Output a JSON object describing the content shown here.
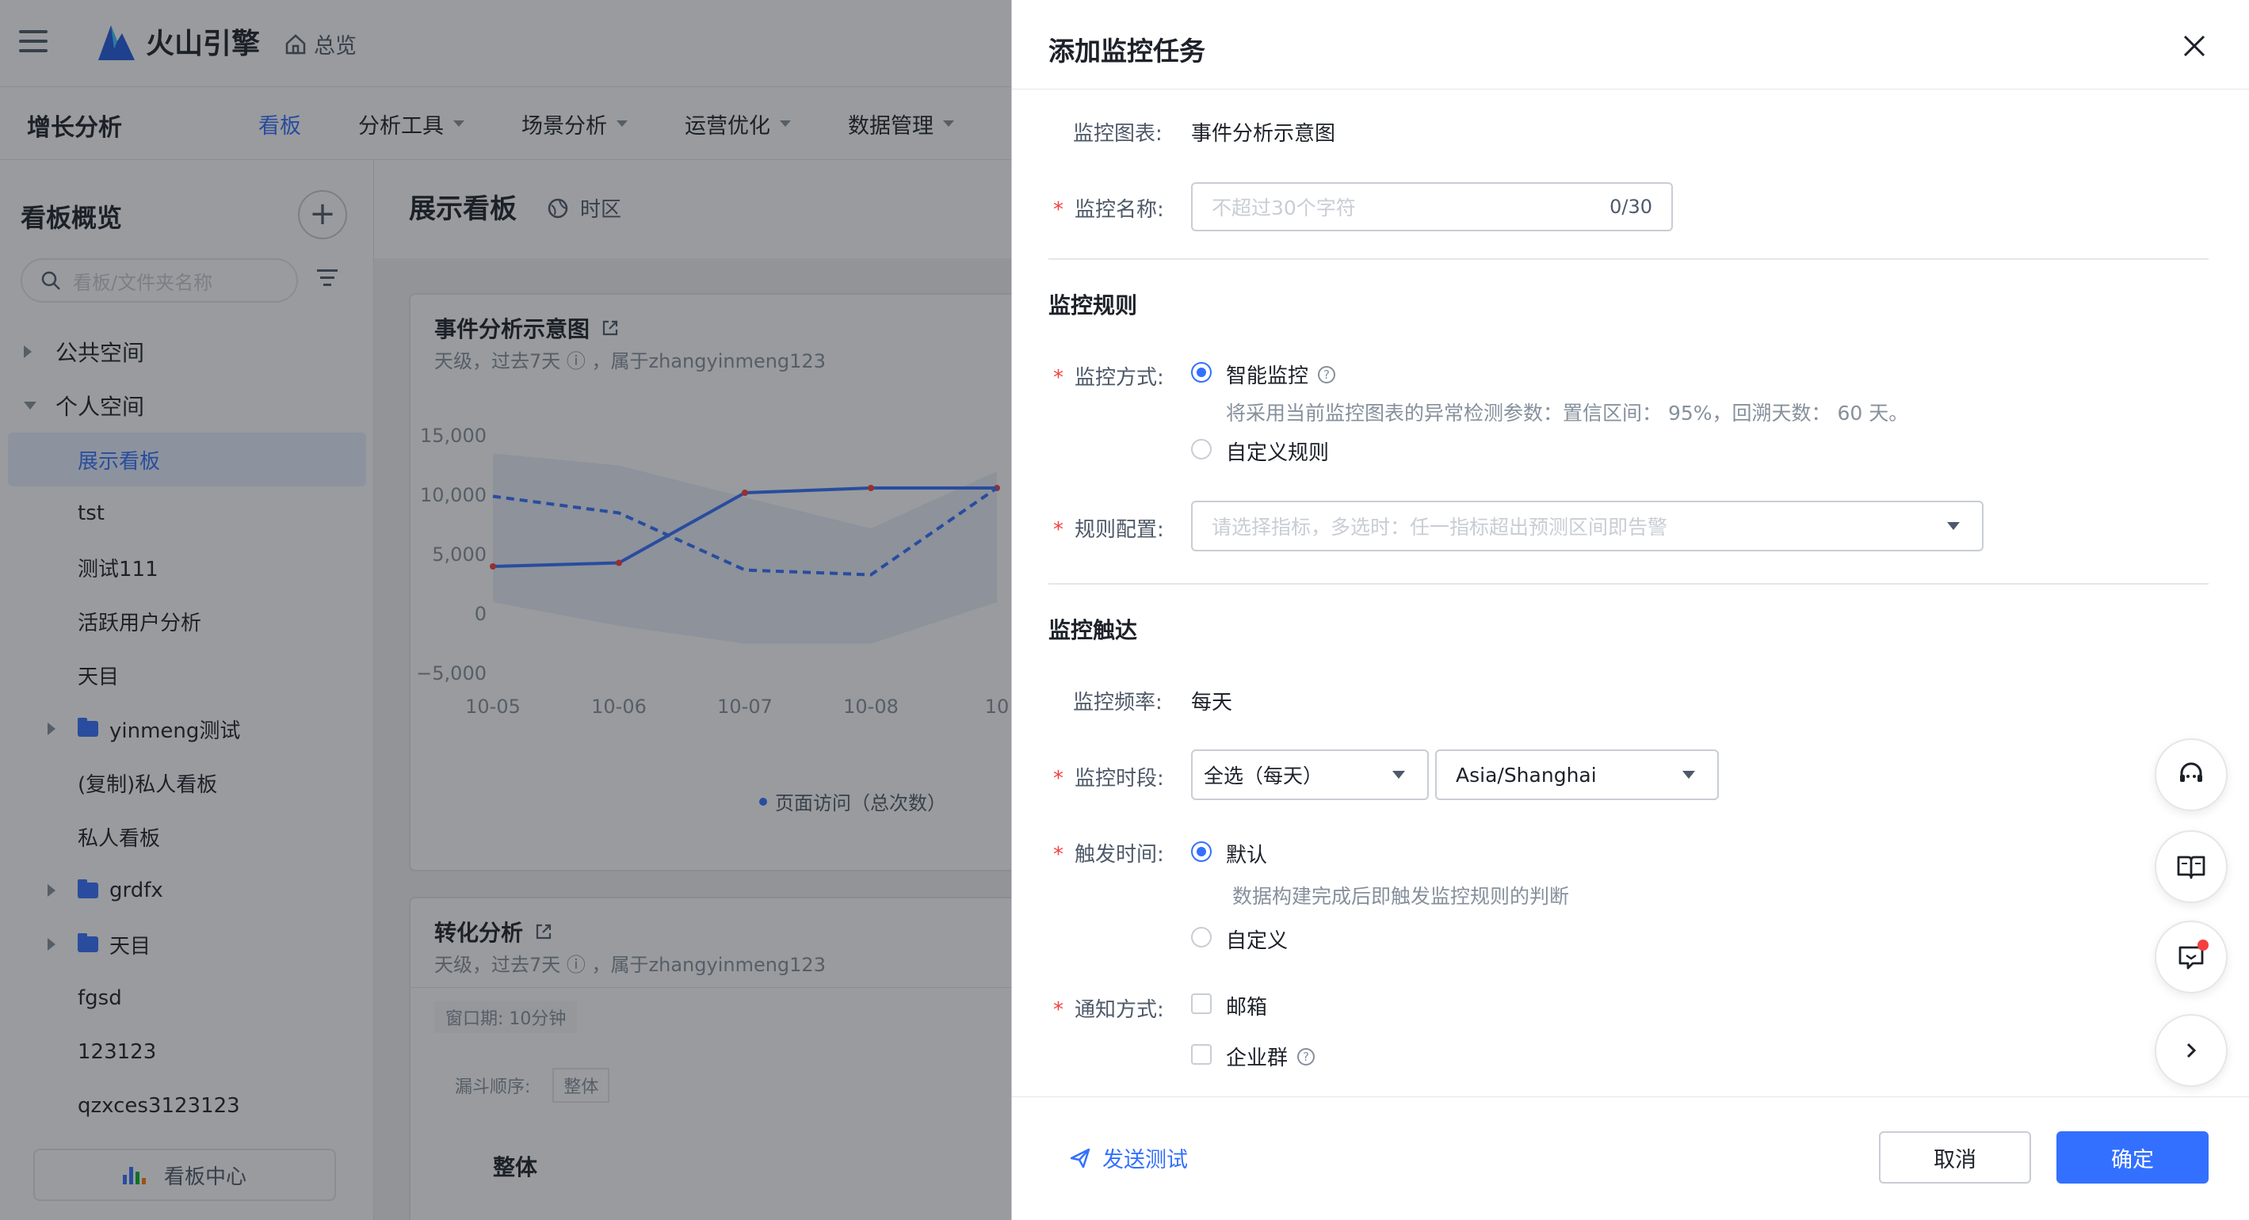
{
  "header": {
    "logo_text": "火山引擎",
    "home_label": "总览"
  },
  "nav": {
    "product_title": "增长分析",
    "items": [
      {
        "label": "看板",
        "active": true,
        "dropdown": false
      },
      {
        "label": "分析工具",
        "active": false,
        "dropdown": true
      },
      {
        "label": "场景分析",
        "active": false,
        "dropdown": true
      },
      {
        "label": "运营优化",
        "active": false,
        "dropdown": true
      },
      {
        "label": "数据管理",
        "active": false,
        "dropdown": true
      }
    ]
  },
  "sidebar": {
    "title": "看板概览",
    "search_placeholder": "看板/文件夹名称",
    "spaces": {
      "public": "公共空间",
      "personal": "个人空间"
    },
    "items": [
      {
        "label": "展示看板",
        "selected": true,
        "folder": false
      },
      {
        "label": "tst",
        "folder": false
      },
      {
        "label": "测试111",
        "folder": false
      },
      {
        "label": "活跃用户分析",
        "folder": false
      },
      {
        "label": "天目",
        "folder": false
      },
      {
        "label": "yinmeng测试",
        "folder": true
      },
      {
        "label": "(复制)私人看板",
        "folder": false
      },
      {
        "label": "私人看板",
        "folder": false
      },
      {
        "label": "grdfx",
        "folder": true
      },
      {
        "label": "天目",
        "folder": true
      },
      {
        "label": "fgsd",
        "folder": false
      },
      {
        "label": "123123",
        "folder": false
      },
      {
        "label": "qzxces3123123",
        "folder": false
      }
    ],
    "footer_label": "看板中心"
  },
  "main": {
    "title": "展示看板",
    "timezone_label": "时区",
    "card1": {
      "title": "事件分析示意图",
      "subtitle": "天级，过去7天 ⓘ ，属于zhangyinmeng123",
      "legend": "页面访问（总次数）"
    },
    "card2": {
      "title": "转化分析",
      "subtitle": "天级，过去7天 ⓘ ，属于zhangyinmeng123",
      "window_label": "窗口期: 10分钟",
      "order_label": "漏斗顺序:",
      "order_value": "整体",
      "whole_label": "整体"
    }
  },
  "chart_data": {
    "type": "line",
    "x": [
      "10-05",
      "10-06",
      "10-07",
      "10-08",
      "10"
    ],
    "series": [
      {
        "name": "页面访问（总次数）",
        "style": "solid",
        "values": [
          4000,
          4300,
          10200,
          10600,
          10600
        ]
      },
      {
        "style": "dashed",
        "values": [
          9900,
          8500,
          3700,
          3300,
          10600
        ]
      }
    ],
    "band": {
      "upper": [
        13500,
        12500,
        9800,
        7200,
        12000
      ],
      "lower": [
        1000,
        -1000,
        -2500,
        -2500,
        1000
      ]
    },
    "yticks": [
      "15,000",
      "10,000",
      "5,000",
      "0",
      "−5,000"
    ],
    "ylim": [
      -5000,
      15000
    ],
    "colors": {
      "line": "#3370ff",
      "point": "#f53f3f",
      "band": "#e8edf8"
    }
  },
  "drawer": {
    "title": "添加监控任务",
    "chart_label": "监控图表:",
    "chart_value": "事件分析示意图",
    "name_label": "监控名称:",
    "name_placeholder": "不超过30个字符",
    "name_count": "0/30",
    "rules_section": "监控规则",
    "mode_label": "监控方式:",
    "mode_smart": "智能监控",
    "mode_smart_hint": "将采用当前监控图表的异常检测参数：置信区间： 95%，回溯天数： 60 天。",
    "mode_custom": "自定义规则",
    "rule_label": "规则配置:",
    "rule_placeholder": "请选择指标，多选时：任一指标超出预测区间即告警",
    "reach_section": "监控触达",
    "freq_label": "监控频率:",
    "freq_value": "每天",
    "period_label": "监控时段:",
    "period_value": "全选（每天）",
    "tz_value": "Asia/Shanghai",
    "trigger_label": "触发时间:",
    "trigger_default": "默认",
    "trigger_default_hint": "数据构建完成后即触发监控规则的判断",
    "trigger_custom": "自定义",
    "notify_label": "通知方式:",
    "notify_email": "邮箱",
    "notify_group": "企业群",
    "send_test": "发送测试",
    "cancel": "取消",
    "confirm": "确定"
  },
  "colors": {
    "accent": "#3370ff",
    "required": "#f53f3f"
  }
}
